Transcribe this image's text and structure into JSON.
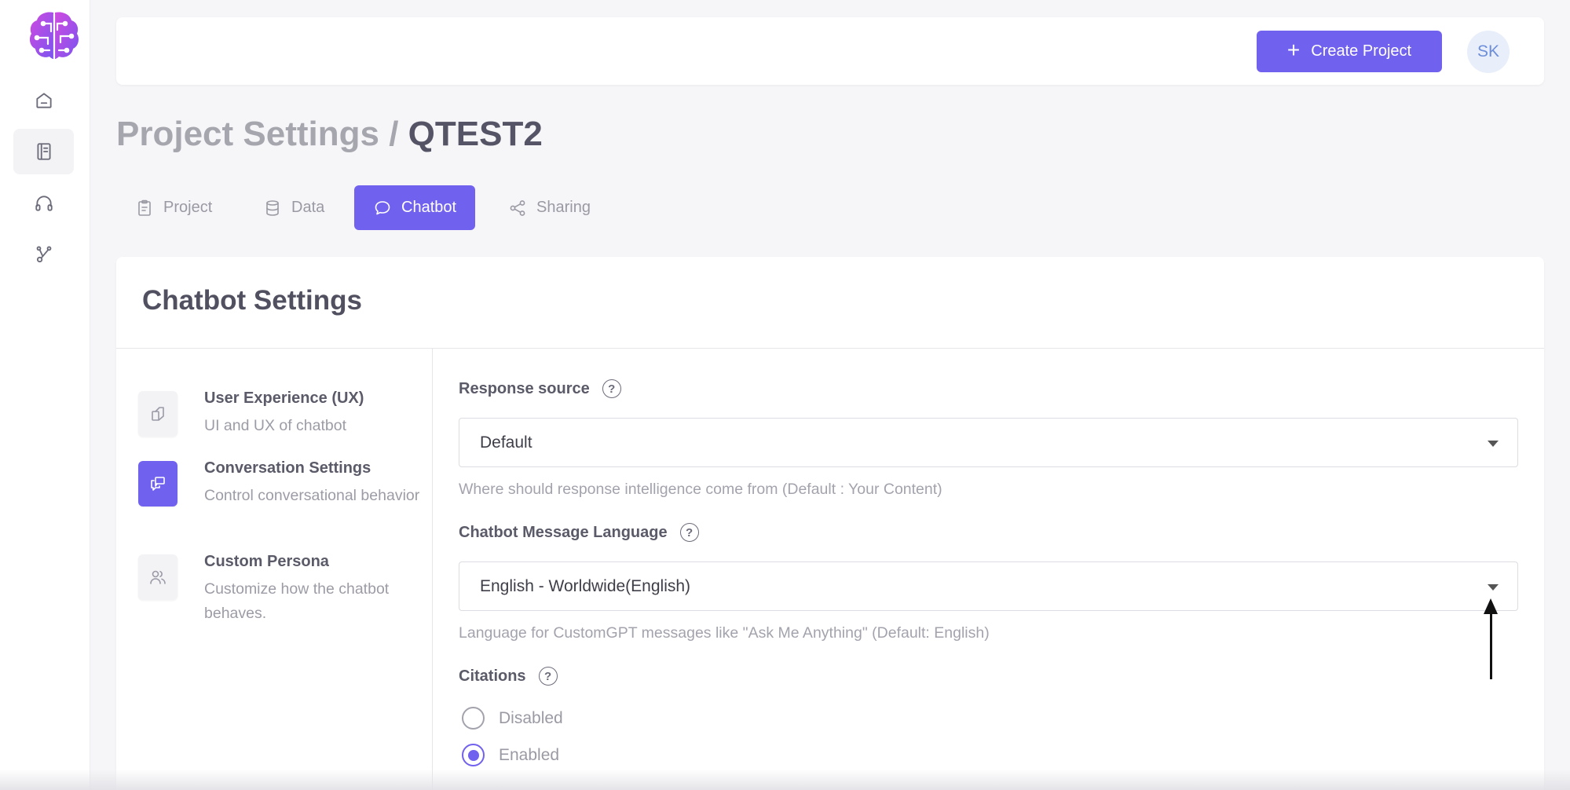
{
  "header": {
    "create_button_label": "Create Project",
    "avatar_initials": "SK"
  },
  "page": {
    "title_prefix": "Project Settings /",
    "project_name": "QTEST2"
  },
  "tabs": [
    {
      "label": "Project",
      "icon": "clipboard-icon"
    },
    {
      "label": "Data",
      "icon": "database-icon"
    },
    {
      "label": "Chatbot",
      "icon": "chat-bubble-icon",
      "active": true
    },
    {
      "label": "Sharing",
      "icon": "share-icon"
    }
  ],
  "settings": {
    "title": "Chatbot Settings",
    "options": [
      {
        "title": "User Experience (UX)",
        "description": "UI and UX of chatbot",
        "icon": "layout-icon"
      },
      {
        "title": "Conversation Settings",
        "description": "Control conversational behavior",
        "icon": "conversation-icon",
        "active": true
      },
      {
        "title": "Custom Persona",
        "description": "Customize how the chatbot behaves.",
        "icon": "users-icon"
      }
    ]
  },
  "form": {
    "response_source": {
      "label": "Response source",
      "value": "Default",
      "hint": "Where should response intelligence come from (Default : Your Content)"
    },
    "language": {
      "label": "Chatbot Message Language",
      "value": "English - Worldwide(English)",
      "hint": "Language for CustomGPT messages like \"Ask Me Anything\" (Default: English)"
    },
    "citations": {
      "label": "Citations",
      "options": [
        "Disabled",
        "Enabled"
      ],
      "selected": "Enabled"
    }
  },
  "colors": {
    "accent": "#7161ef",
    "background": "#f6f6f8"
  }
}
